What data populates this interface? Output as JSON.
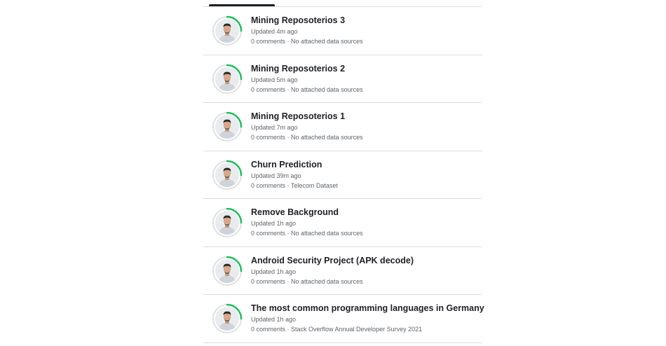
{
  "colors": {
    "ring_progress": "#20be5c",
    "ring_track": "#e0e0e0",
    "divider": "#dadce0",
    "title_text": "#202124",
    "meta_text": "#5f6368"
  },
  "notebooks": [
    {
      "title": "Mining Reposoterios 3",
      "updated": "Updated 4m ago",
      "details": "0 comments · No attached data sources"
    },
    {
      "title": "Mining Reposoterios 2",
      "updated": "Updated 5m ago",
      "details": "0 comments · No attached data sources"
    },
    {
      "title": "Mining Reposoterios 1",
      "updated": "Updated 7m ago",
      "details": "0 comments · No attached data sources"
    },
    {
      "title": "Churn Prediction",
      "updated": "Updated 39m ago",
      "details": "0 comments · Telecom Dataset"
    },
    {
      "title": "Remove Background",
      "updated": "Updated 1h ago",
      "details": "0 comments · No attached data sources"
    },
    {
      "title": "Android Security Project (APK decode)",
      "updated": "Updated 1h ago",
      "details": "0 comments · No attached data sources"
    },
    {
      "title": "The most common programming languages in Germany",
      "updated": "Updated 1h ago",
      "details": "0 comments · Stack Overflow Annual Developer Survey 2021"
    }
  ]
}
